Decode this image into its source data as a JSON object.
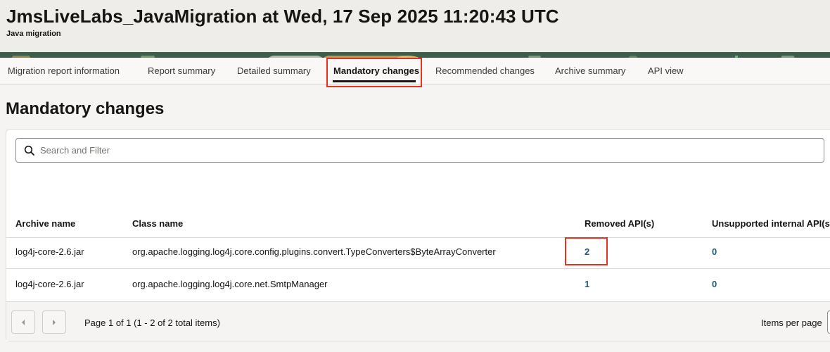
{
  "header": {
    "title": "JmsLiveLabs_JavaMigration at Wed, 17 Sep 2025 11:20:43 UTC",
    "subtitle": "Java migration"
  },
  "tabs": [
    {
      "label": "Migration report information"
    },
    {
      "label": "Report summary"
    },
    {
      "label": "Detailed summary"
    },
    {
      "label": "Mandatory changes",
      "selected": true
    },
    {
      "label": "Recommended changes"
    },
    {
      "label": "Archive summary"
    },
    {
      "label": "API view"
    }
  ],
  "page_title": "Mandatory changes",
  "search": {
    "placeholder": "Search and Filter",
    "value": ""
  },
  "table": {
    "columns": [
      "Archive name",
      "Class name",
      "Removed API(s)",
      "Unsupported internal API(s)"
    ],
    "rows": [
      [
        "log4j-core-2.6.jar",
        "org.apache.logging.log4j.core.config.plugins.convert.TypeConverters$ByteArrayConverter",
        "2",
        "0"
      ],
      [
        "log4j-core-2.6.jar",
        "org.apache.logging.log4j.core.net.SmtpManager",
        "1",
        "0"
      ]
    ]
  },
  "pagination": {
    "text": "Page 1 of 1 (1 - 2 of 2 total items)",
    "items_per_page_label": "Items per page"
  },
  "colors": {
    "link": "#1d5a80",
    "highlight_box": "#e5331f",
    "banner_green": "#3f5d4b"
  }
}
